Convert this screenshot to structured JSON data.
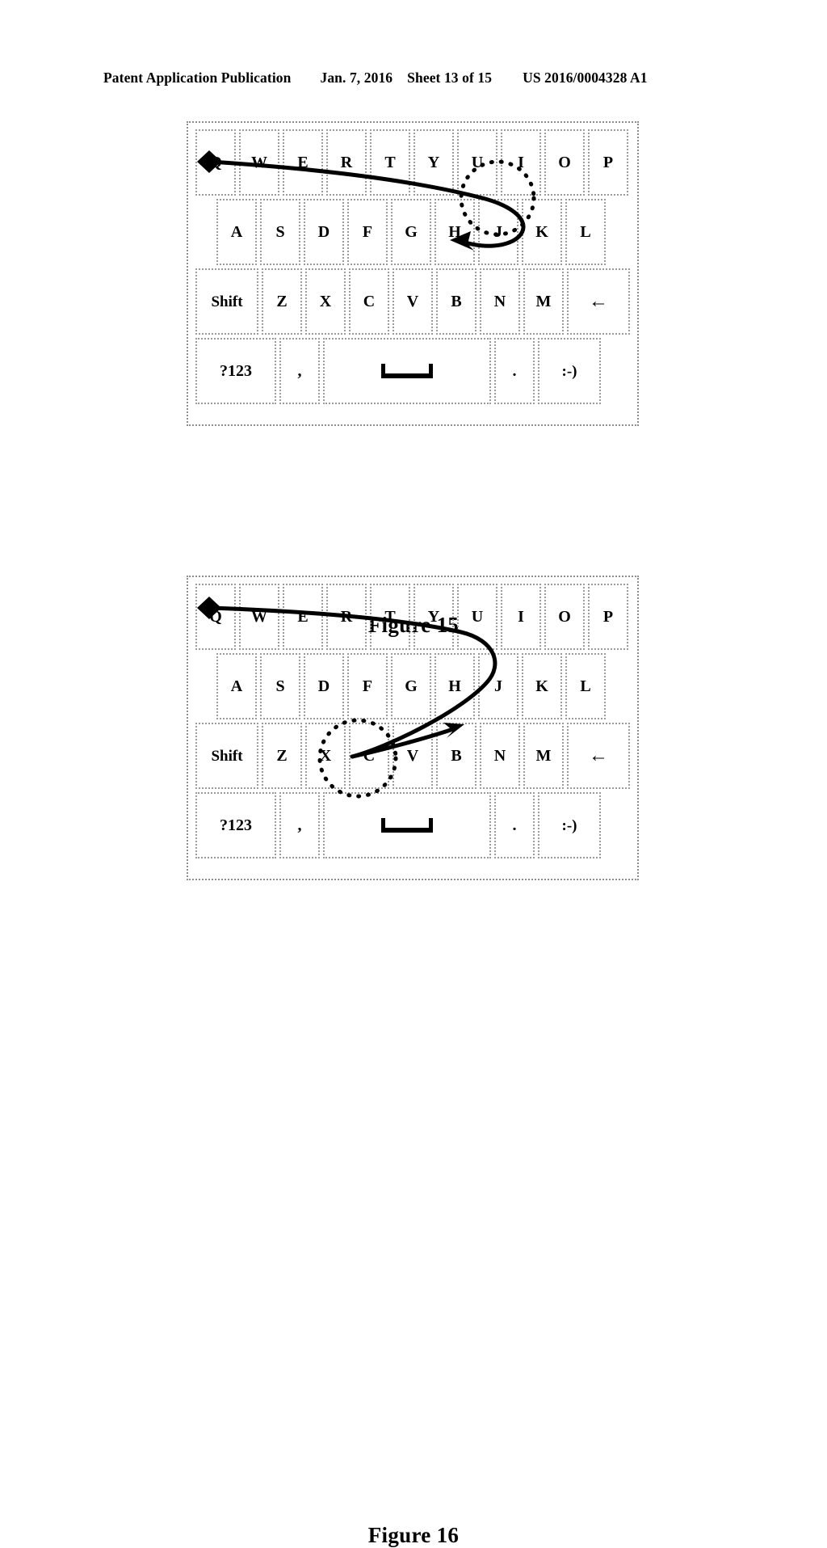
{
  "header": {
    "publication": "Patent Application Publication",
    "date": "Jan. 7, 2016",
    "sheet": "Sheet 13 of 15",
    "number": "US 2016/0004328 A1"
  },
  "keyboard": {
    "rows": [
      {
        "name": "top-row",
        "keys": [
          {
            "label": "Q",
            "type": "letter"
          },
          {
            "label": "W",
            "type": "letter"
          },
          {
            "label": "E",
            "type": "letter"
          },
          {
            "label": "R",
            "type": "letter"
          },
          {
            "label": "T",
            "type": "letter"
          },
          {
            "label": "Y",
            "type": "letter"
          },
          {
            "label": "U",
            "type": "letter"
          },
          {
            "label": "I",
            "type": "letter"
          },
          {
            "label": "O",
            "type": "letter"
          },
          {
            "label": "P",
            "type": "letter"
          }
        ]
      },
      {
        "name": "home-row",
        "keys": [
          {
            "label": "A",
            "type": "letter"
          },
          {
            "label": "S",
            "type": "letter"
          },
          {
            "label": "D",
            "type": "letter"
          },
          {
            "label": "F",
            "type": "letter"
          },
          {
            "label": "G",
            "type": "letter"
          },
          {
            "label": "H",
            "type": "letter"
          },
          {
            "label": "J",
            "type": "letter"
          },
          {
            "label": "K",
            "type": "letter"
          },
          {
            "label": "L",
            "type": "letter"
          }
        ]
      },
      {
        "name": "bottom-letter-row",
        "keys": [
          {
            "label": "Shift",
            "type": "shift"
          },
          {
            "label": "Z",
            "type": "letter"
          },
          {
            "label": "X",
            "type": "letter"
          },
          {
            "label": "C",
            "type": "letter"
          },
          {
            "label": "V",
            "type": "letter"
          },
          {
            "label": "B",
            "type": "letter"
          },
          {
            "label": "N",
            "type": "letter"
          },
          {
            "label": "M",
            "type": "letter"
          },
          {
            "label": "←",
            "type": "back"
          }
        ]
      },
      {
        "name": "function-row",
        "keys": [
          {
            "label": "?123",
            "type": "num"
          },
          {
            "label": ",",
            "type": "comma"
          },
          {
            "label": "",
            "type": "space"
          },
          {
            "label": ".",
            "type": "period"
          },
          {
            "label": ":-)",
            "type": "smiley"
          }
        ]
      }
    ]
  },
  "figures": [
    {
      "id": "figure-15",
      "caption": "Figure 15",
      "gesture": {
        "start_key": "Q",
        "end_key": "H",
        "loop_center_key": "I",
        "description": "Trace from Q across top row to I, loop clockwise, arrow terminates on H"
      }
    },
    {
      "id": "figure-16",
      "caption": "Figure 16",
      "gesture": {
        "start_key": "Q",
        "end_key": "G",
        "loop_center_key": "X",
        "description": "Trace from Q across top row curving down past U to X/C, reverses with arrow pointing up-right toward G"
      }
    }
  ],
  "colors": {
    "ink": "#000000",
    "key_border": "#9a9a9a",
    "frame_border": "#8e8e8e",
    "background": "#ffffff"
  }
}
